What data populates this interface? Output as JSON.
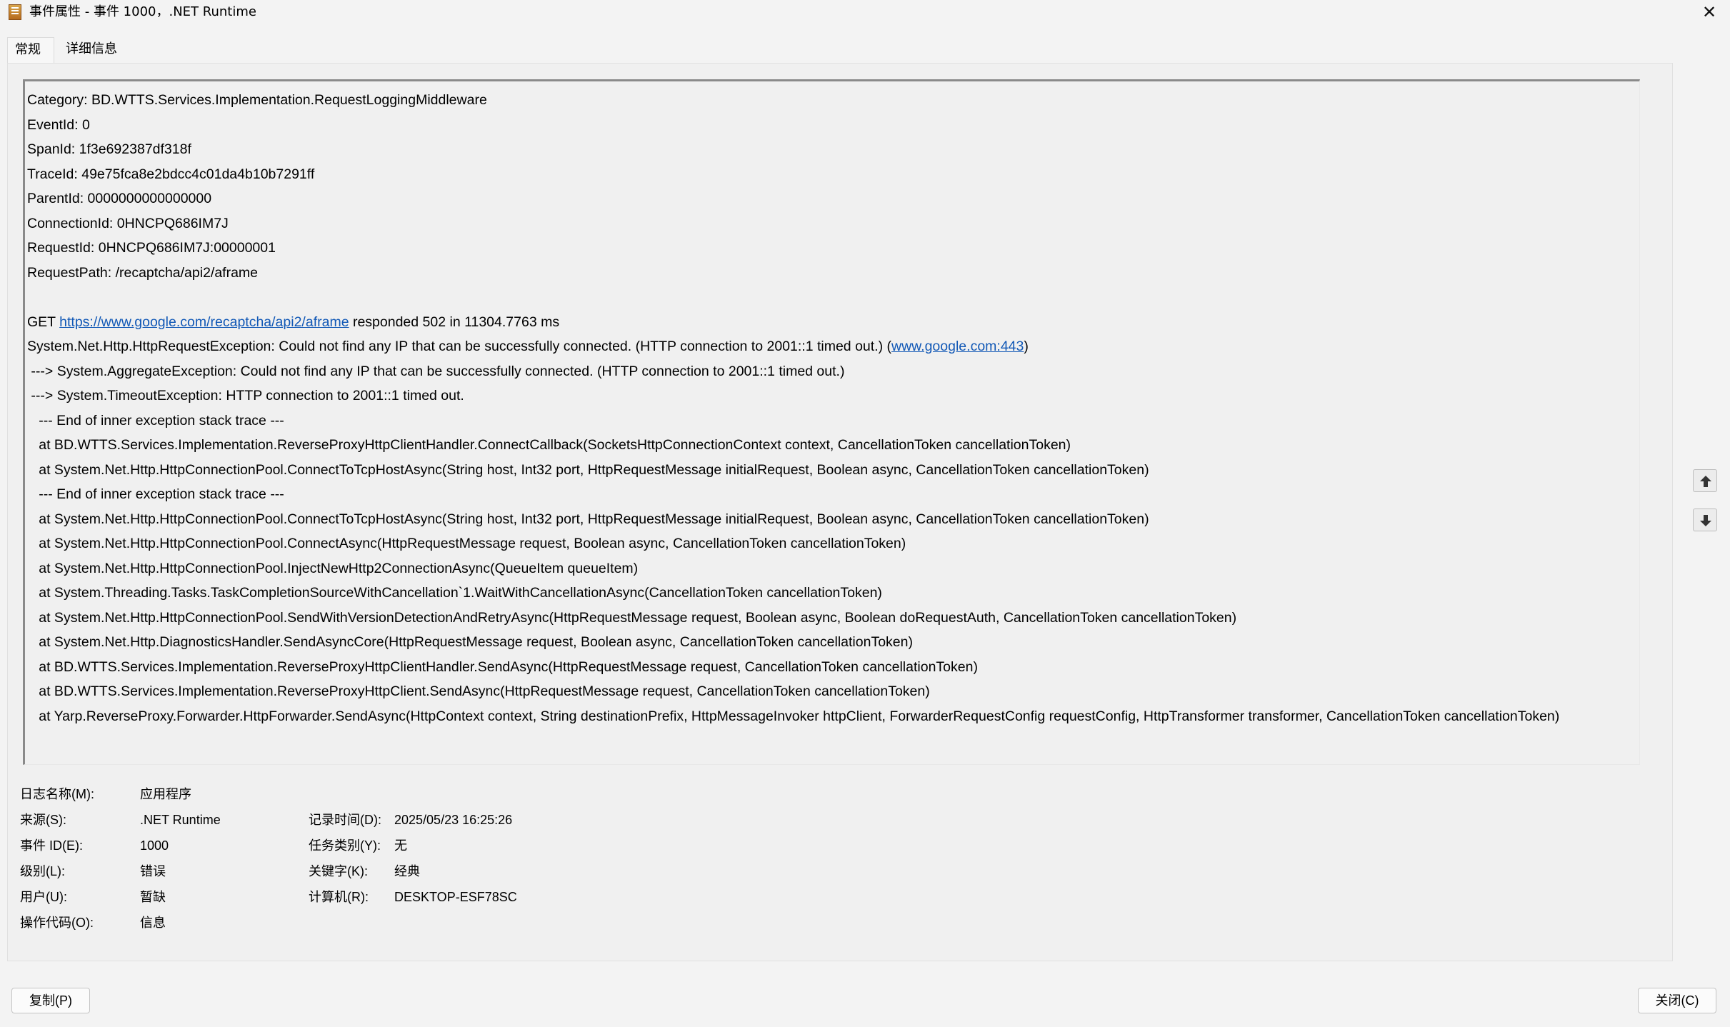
{
  "window": {
    "title": "事件属性 - 事件 1000，.NET Runtime",
    "app_icon": "event-viewer-properties-icon",
    "close_icon": "close-icon",
    "close_glyph": "✕"
  },
  "tabs": [
    {
      "label": "常规",
      "active": true
    },
    {
      "label": "详细信息",
      "active": false
    }
  ],
  "event_message": {
    "lines": [
      "Category: BD.WTTS.Services.Implementation.RequestLoggingMiddleware",
      "EventId: 0",
      "SpanId: 1f3e692387df318f",
      "TraceId: 49e75fca8e2bdcc4c01da4b10b7291ff",
      "ParentId: 0000000000000000",
      "ConnectionId: 0HNCPQ686IM7J",
      "RequestId: 0HNCPQ686IM7J:00000001",
      "RequestPath: /recaptcha/api2/aframe",
      "",
      "__GET__",
      "__SYS__",
      " ---> System.AggregateException: Could not find any IP that can be successfully connected. (HTTP connection to 2001::1 timed out.)",
      " ---> System.TimeoutException: HTTP connection to 2001::1 timed out.",
      "   --- End of inner exception stack trace ---",
      "   at BD.WTTS.Services.Implementation.ReverseProxyHttpClientHandler.ConnectCallback(SocketsHttpConnectionContext context, CancellationToken cancellationToken)",
      "   at System.Net.Http.HttpConnectionPool.ConnectToTcpHostAsync(String host, Int32 port, HttpRequestMessage initialRequest, Boolean async, CancellationToken cancellationToken)",
      "   --- End of inner exception stack trace ---",
      "   at System.Net.Http.HttpConnectionPool.ConnectToTcpHostAsync(String host, Int32 port, HttpRequestMessage initialRequest, Boolean async, CancellationToken cancellationToken)",
      "   at System.Net.Http.HttpConnectionPool.ConnectAsync(HttpRequestMessage request, Boolean async, CancellationToken cancellationToken)",
      "   at System.Net.Http.HttpConnectionPool.InjectNewHttp2ConnectionAsync(QueueItem queueItem)",
      "   at System.Threading.Tasks.TaskCompletionSourceWithCancellation`1.WaitWithCancellationAsync(CancellationToken cancellationToken)",
      "   at System.Net.Http.HttpConnectionPool.SendWithVersionDetectionAndRetryAsync(HttpRequestMessage request, Boolean async, Boolean doRequestAuth, CancellationToken cancellationToken)",
      "   at System.Net.Http.DiagnosticsHandler.SendAsyncCore(HttpRequestMessage request, Boolean async, CancellationToken cancellationToken)",
      "   at BD.WTTS.Services.Implementation.ReverseProxyHttpClientHandler.SendAsync(HttpRequestMessage request, CancellationToken cancellationToken)",
      "   at BD.WTTS.Services.Implementation.ReverseProxyHttpClient.SendAsync(HttpRequestMessage request, CancellationToken cancellationToken)",
      "   at Yarp.ReverseProxy.Forwarder.HttpForwarder.SendAsync(HttpContext context, String destinationPrefix, HttpMessageInvoker httpClient, ForwarderRequestConfig requestConfig, HttpTransformer transformer, CancellationToken cancellationToken)"
    ],
    "get_line": {
      "prefix": "GET ",
      "link": "https://www.google.com/recaptcha/api2/aframe",
      "suffix": " responded 502 in 11304.7763 ms"
    },
    "system_line": {
      "prefix": "System.Net.Http.HttpRequestException: Could not find any IP that can be successfully connected. (HTTP connection to 2001::1 timed out.) (",
      "link": "www.google.com:443",
      "suffix": ")"
    }
  },
  "scroll": {
    "up_icon": "arrow-up-icon",
    "down_icon": "arrow-down-icon"
  },
  "properties": {
    "log_name_label": "日志名称(M):",
    "log_name_value": "应用程序",
    "source_label": "来源(S):",
    "source_value": ".NET Runtime",
    "logged_label": "记录时间(D):",
    "logged_value": "2025/05/23 16:25:26",
    "event_id_label": "事件 ID(E):",
    "event_id_value": "1000",
    "task_category_label": "任务类别(Y):",
    "task_category_value": "无",
    "level_label": "级别(L):",
    "level_value": "错误",
    "keywords_label": "关键字(K):",
    "keywords_value": "经典",
    "user_label": "用户(U):",
    "user_value": "暂缺",
    "computer_label": "计算机(R):",
    "computer_value": "DESKTOP-ESF78SC",
    "opcode_label": "操作代码(O):",
    "opcode_value": "信息"
  },
  "buttons": {
    "copy": "复制(P)",
    "close": "关闭(C)"
  }
}
